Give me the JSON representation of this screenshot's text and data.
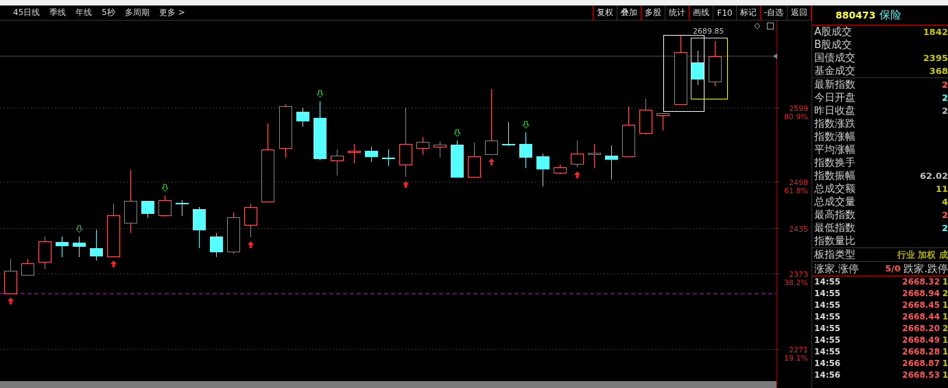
{
  "toolbar": {
    "periods": [
      "45日线",
      "季线",
      "年线",
      "5秒",
      "多周期",
      "更多 >"
    ],
    "buttons": [
      "复权",
      "叠加",
      "多股",
      "统计",
      "画线",
      "F10",
      "标记",
      "-自选",
      "返回"
    ]
  },
  "chart": {
    "annotation": "2689.85",
    "levels": [
      {
        "price": "2599",
        "ratio": "80.9%"
      },
      {
        "price": "2498",
        "ratio": "61.8%"
      },
      {
        "price": "2435"
      },
      {
        "price": "2373",
        "ratio": "38.2%"
      },
      {
        "price": "2271",
        "ratio": "19.1%"
      }
    ]
  },
  "panel": {
    "code": "880473",
    "name": "保险",
    "sections": [
      [
        {
          "label": "A股成交",
          "value": "1842",
          "color": "#c8c800"
        },
        {
          "label": "B股成交"
        },
        {
          "label": "国债成交",
          "value": "2395",
          "color": "#c8c800"
        },
        {
          "label": "基金成交",
          "value": "368",
          "color": "#c8c800"
        }
      ],
      [
        {
          "label": "最新指数",
          "value": "2",
          "color": "#ff5555"
        },
        {
          "label": "今日开盘",
          "value": "2",
          "color": "#55ffff"
        },
        {
          "label": "昨日收盘",
          "value": "2",
          "color": "#c0c0c0"
        },
        {
          "label": "指数涨跌"
        },
        {
          "label": "指数涨幅"
        },
        {
          "label": "平均涨幅"
        },
        {
          "label": "指数换手"
        },
        {
          "label": "指数振幅",
          "value": "62.02",
          "color": "#c0c0c0"
        },
        {
          "label": "总成交额",
          "value": "11",
          "color": "#c8c800"
        },
        {
          "label": "总成交量",
          "value": "4",
          "color": "#c8c800"
        },
        {
          "label": "最高指数",
          "value": "2",
          "color": "#ff5555"
        },
        {
          "label": "最低指数",
          "value": "2",
          "color": "#55ffff"
        },
        {
          "label": "指数量比"
        }
      ],
      [
        {
          "label": "板指类型",
          "value": "行业 加权 成",
          "color": "#b0b000"
        }
      ]
    ],
    "breadth": {
      "up_label": "涨家.涨停",
      "count": "5/0",
      "down_label": "跌家.跌停"
    },
    "ticks": [
      {
        "time": "14:55",
        "price": "2668.32",
        "volume": "1"
      },
      {
        "time": "14:55",
        "price": "2668.94",
        "volume": "2"
      },
      {
        "time": "14:55",
        "price": "2668.45",
        "volume": "1"
      },
      {
        "time": "14:55",
        "price": "2668.44",
        "volume": "1"
      },
      {
        "time": "14:55",
        "price": "2668.20",
        "volume": "2"
      },
      {
        "time": "14:55",
        "price": "2668.49",
        "volume": "1"
      },
      {
        "time": "14:55",
        "price": "2668.28",
        "volume": "1"
      },
      {
        "time": "14:56",
        "price": "2668.87",
        "volume": "1"
      },
      {
        "time": "14:56",
        "price": "2668.53",
        "volume": "1"
      }
    ]
  }
}
